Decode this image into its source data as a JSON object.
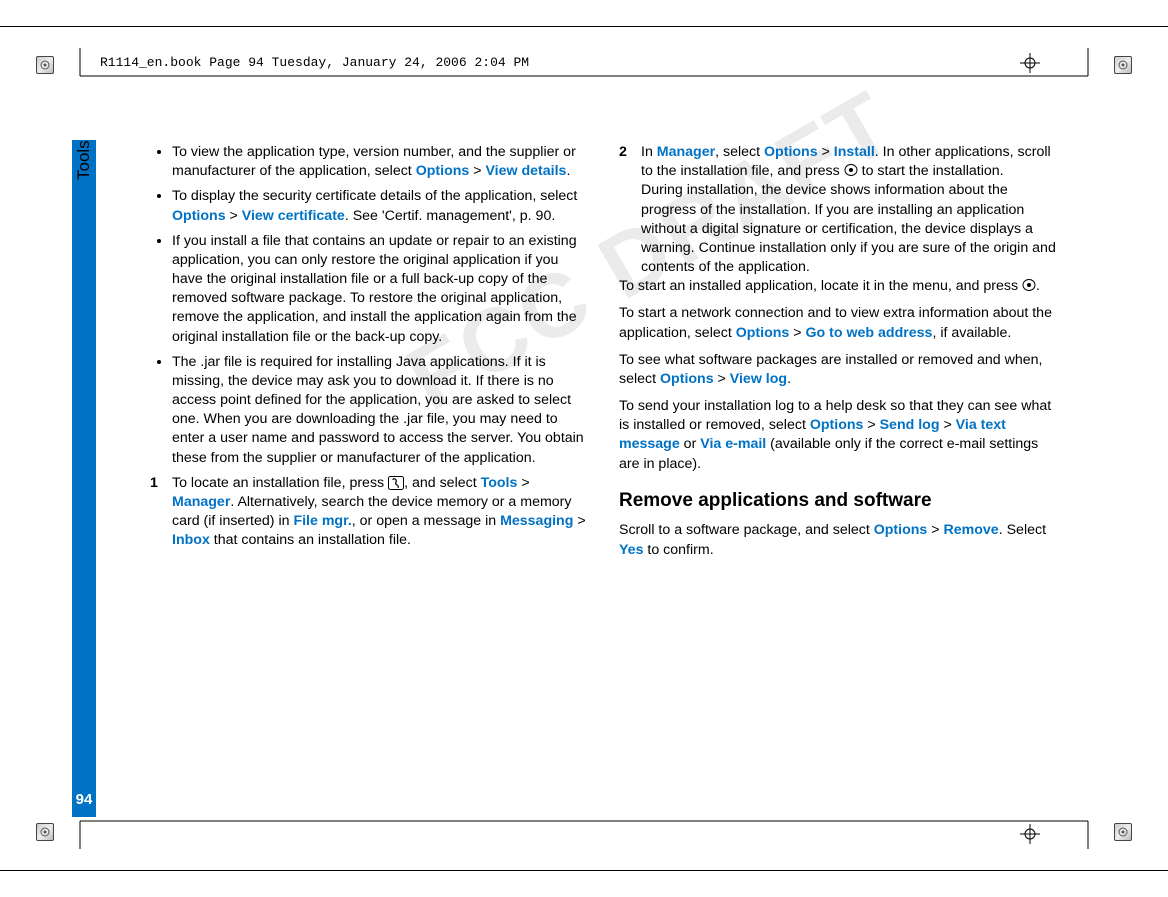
{
  "header": {
    "book_info": "R1114_en.book  Page 94  Tuesday, January 24, 2006  2:04 PM"
  },
  "sidebar": {
    "section_label": "Tools",
    "page_number": "94"
  },
  "watermark": "FCC DRAFT",
  "body": {
    "bullets": [
      {
        "pre": "To view the application type, version number, and the supplier or manufacturer of the application, select ",
        "l1": "Options",
        "sep1": " > ",
        "l2": "View details",
        "post": "."
      },
      {
        "pre": "To display the security certificate details of the application, select ",
        "l1": "Options",
        "sep1": " > ",
        "l2": "View certificate",
        "post": ". See 'Certif. management', p. 90."
      },
      {
        "pre": "If you install a file that contains an update or repair to an existing application, you can only restore the original application if you have the original installation file or a full back-up copy of the removed software package. To restore the original application, remove the application, and install the application again from the original installation file or the back-up copy.",
        "l1": "",
        "sep1": "",
        "l2": "",
        "post": ""
      },
      {
        "pre": "The .jar file is required for installing Java applications. If it is missing, the device may ask you to download it. If there is no access point defined for the application, you are asked to select one. When you are downloading the .jar file, you may need to enter a user name and password to access the server. You obtain these from the supplier or manufacturer of the application.",
        "l1": "",
        "sep1": "",
        "l2": "",
        "post": ""
      }
    ],
    "step1": {
      "pre": "To locate an installation file, press ",
      "after_icon": ", and select ",
      "l1": "Tools",
      "sep1": " > ",
      "l2": "Manager",
      "mid1": ". Alternatively, search the device memory or a memory card (if inserted) in ",
      "l3": "File mgr.",
      "mid2": ", or open a message in ",
      "l4": "Messaging",
      "sep2": " > ",
      "l5": "Inbox",
      "post": " that contains an installation file."
    },
    "step2": {
      "pre": "In ",
      "l1": "Manager",
      "mid1": ", select ",
      "l2": "Options",
      "sep1": " > ",
      "l3": "Install",
      "mid2": ". In other applications, scroll to the installation file, and press ",
      "post_icon": " to start the installation.",
      "para2": "During installation, the device shows information about the progress of the installation. If you are installing an application without a digital signature or certification, the device displays a warning. Continue installation only if you are sure of the origin and contents of the application."
    },
    "p_start": {
      "pre": "To start an installed application, locate it in the menu, and press ",
      "post": "."
    },
    "p_net": {
      "pre": "To start a network connection and to view extra information about the application, select ",
      "l1": "Options",
      "sep1": " > ",
      "l2": "Go to web address",
      "post": ", if available."
    },
    "p_log": {
      "pre": "To see what software packages are installed or removed and when, select ",
      "l1": "Options",
      "sep1": " > ",
      "l2": "View log",
      "post": "."
    },
    "p_send": {
      "pre": "To send your installation log to a help desk so that they can see what is installed or removed, select ",
      "l1": "Options",
      "sep1": " > ",
      "l2": "Send log",
      "sep2": " > ",
      "l3": "Via text message",
      "mid": " or ",
      "l4": "Via e-mail",
      "post": " (available only if the correct e-mail settings are in place)."
    },
    "subhead": "Remove applications and software",
    "p_remove": {
      "pre": "Scroll to a software package, and select ",
      "l1": "Options",
      "sep1": " > ",
      "l2": "Remove",
      "mid": ". Select ",
      "l3": "Yes",
      "post": " to confirm."
    }
  }
}
